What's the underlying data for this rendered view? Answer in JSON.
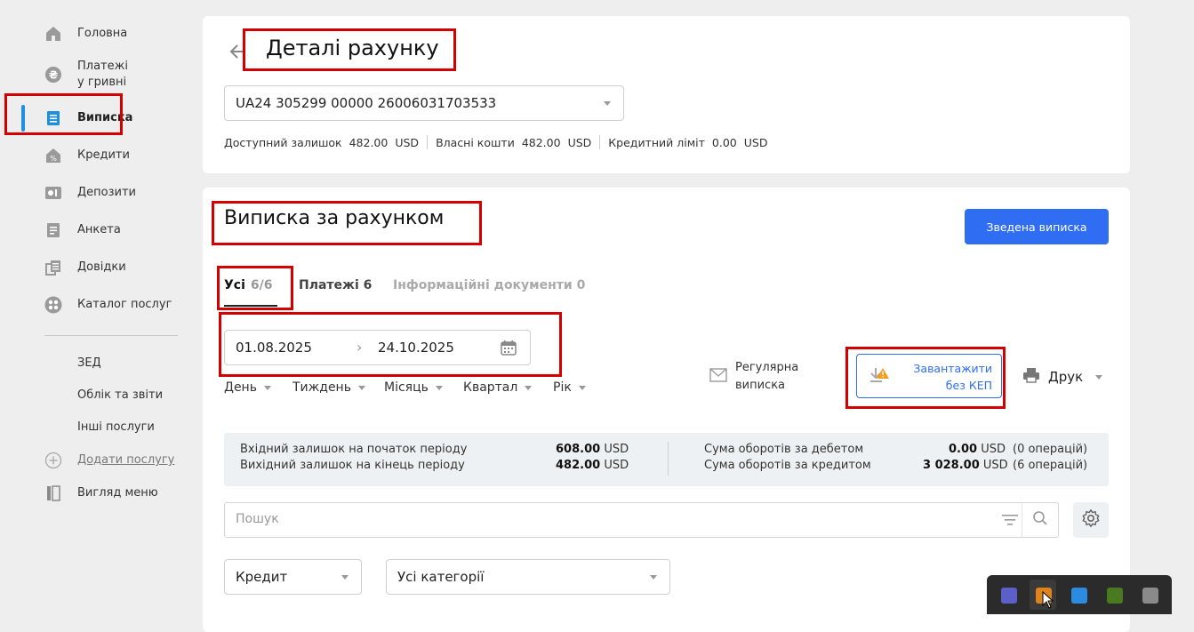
{
  "sidebar": {
    "items": [
      {
        "label": "Головна",
        "icon": "home-icon"
      },
      {
        "label": "Платежі\nу гривні",
        "icon": "hryvnia-icon"
      },
      {
        "label": "Виписка",
        "icon": "statement-icon",
        "active": true
      },
      {
        "label": "Кредити",
        "icon": "credit-house-icon"
      },
      {
        "label": "Депозити",
        "icon": "deposit-icon"
      },
      {
        "label": "Анкета",
        "icon": "form-icon"
      },
      {
        "label": "Довідки",
        "icon": "documents-icon"
      },
      {
        "label": "Каталог послуг",
        "icon": "catalog-icon"
      }
    ],
    "extra": [
      "ЗЕД",
      "Облік та звіти",
      "Інші послуги"
    ],
    "add_service": "Додати послугу",
    "view_menu": "Вигляд меню"
  },
  "account": {
    "title": "Деталі рахунку",
    "number": "UA24 305299 00000 26006031703533",
    "available_label": "Доступний залишок",
    "available_value": "482.00",
    "own_label": "Власні кошти",
    "own_value": "482.00",
    "limit_label": "Кредитний ліміт",
    "limit_value": "0.00",
    "currency": "USD"
  },
  "statement": {
    "title": "Виписка за рахунком",
    "summary_button": "Зведена виписка",
    "tabs": [
      {
        "label": "Усі",
        "count": "6/6"
      },
      {
        "label": "Платежі",
        "count": "6"
      },
      {
        "label": "Інформаційні документи",
        "count": "0"
      }
    ],
    "date_from": "01.08.2025",
    "date_to": "24.10.2025",
    "periods": [
      "День",
      "Тиждень",
      "Місяць",
      "Квартал",
      "Рік"
    ],
    "regular_line1": "Регулярна",
    "regular_line2": "виписка",
    "download_line1": "Завантажити",
    "download_line2": "без КЕП",
    "print_label": "Друк"
  },
  "summary": {
    "opening_label": "Вхідний залишок на початок періоду",
    "opening_value": "608.00",
    "closing_label": "Вихідний залишок на кінець періоду",
    "closing_value": "482.00",
    "debit_label": "Сума оборотів за дебетом",
    "debit_value": "0.00",
    "debit_ops": "(0 операцій)",
    "credit_label": "Сума оборотів за кредитом",
    "credit_value": "3 028.00",
    "credit_ops": "(6 операцій)",
    "currency": "USD"
  },
  "filters": {
    "search_placeholder": "Пошук",
    "direction": "Кредит",
    "category": "Усі категорії"
  },
  "colors": {
    "accent": "#2f6df2",
    "active_bar": "#1f8fe0",
    "highlight": "#d40000"
  }
}
